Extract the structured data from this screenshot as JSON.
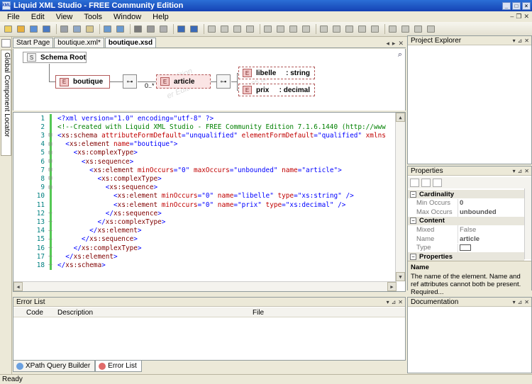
{
  "window": {
    "title": "Liquid XML Studio - FREE Community Edition",
    "app_icon_text": "XML"
  },
  "menu": [
    "File",
    "Edit",
    "View",
    "Tools",
    "Window",
    "Help"
  ],
  "toolbar": {
    "icons": [
      "new-file-icon",
      "open-folder-icon",
      "save-icon",
      "save-all-icon",
      "cut-icon",
      "copy-icon",
      "paste-icon",
      "undo-icon",
      "redo-icon",
      "print-icon",
      "print-preview-icon",
      "find-icon",
      "back-icon",
      "forward-icon",
      "schema-tree-icon",
      "schema-tree-icon",
      "schema-tree-icon",
      "schema-tree-icon",
      "element-icon",
      "element-icon",
      "element-icon",
      "element-icon",
      "attribute-icon",
      "attribute-icon",
      "attribute-icon",
      "attribute-icon",
      "attribute-icon",
      "validate-icon",
      "xml-icon",
      "search-icon",
      "options-icon"
    ]
  },
  "left_strip": {
    "tab_label": "Global Component Locator"
  },
  "doc_tabs": [
    {
      "label": "Start Page",
      "active": false
    },
    {
      "label": "boutique.xml*",
      "active": false
    },
    {
      "label": "boutique.xsd",
      "active": true
    }
  ],
  "schema_diagram": {
    "root_label": "Schema Root",
    "root_tag": "S",
    "element_tag": "E",
    "boutique": "boutique",
    "article": "article",
    "occurs": "0..*",
    "libelle": {
      "name": "libelle",
      "type": ": string"
    },
    "prix": {
      "name": "prix",
      "type": ": decimal"
    },
    "watermark_1": "mas are",
    "watermark_2": "nity Edition",
    "watermark_3": "er Edition)"
  },
  "code_lines": [
    {
      "n": "1",
      "fold": "",
      "parts": [
        [
          "p",
          "<?xml version=\"1.0\" encoding=\"utf-8\" ?>"
        ]
      ]
    },
    {
      "n": "2",
      "fold": "",
      "parts": [
        [
          "c",
          "<!--Created with Liquid XML Studio - FREE Community Edition 7.1.6.1440 (http://www"
        ]
      ]
    },
    {
      "n": "3",
      "fold": "⊟",
      "parts": [
        [
          "p",
          "<"
        ],
        [
          "k",
          "xs:schema"
        ],
        [
          "a",
          " attributeFormDefault"
        ],
        [
          "p",
          "=\"unqualified\""
        ],
        [
          "a",
          " elementFormDefault"
        ],
        [
          "p",
          "=\"qualified\""
        ],
        [
          "a",
          " xmlns"
        ]
      ]
    },
    {
      "n": "4",
      "fold": "⊟",
      "parts": [
        [
          "p",
          "  <"
        ],
        [
          "k",
          "xs:element"
        ],
        [
          "a",
          " name"
        ],
        [
          "p",
          "=\"boutique\">"
        ]
      ]
    },
    {
      "n": "5",
      "fold": "⊟",
      "parts": [
        [
          "p",
          "    <"
        ],
        [
          "k",
          "xs:complexType"
        ],
        [
          "p",
          ">"
        ]
      ]
    },
    {
      "n": "6",
      "fold": "⊟",
      "parts": [
        [
          "p",
          "      <"
        ],
        [
          "k",
          "xs:sequence"
        ],
        [
          "p",
          ">"
        ]
      ]
    },
    {
      "n": "7",
      "fold": "⊟",
      "parts": [
        [
          "p",
          "        <"
        ],
        [
          "k",
          "xs:element"
        ],
        [
          "a",
          " minOccurs"
        ],
        [
          "p",
          "=\"0\""
        ],
        [
          "a",
          " maxOccurs"
        ],
        [
          "p",
          "=\"unbounded\""
        ],
        [
          "a",
          " name"
        ],
        [
          "p",
          "=\"article\">"
        ]
      ]
    },
    {
      "n": "8",
      "fold": "⊟",
      "parts": [
        [
          "p",
          "          <"
        ],
        [
          "k",
          "xs:complexType"
        ],
        [
          "p",
          ">"
        ]
      ]
    },
    {
      "n": "9",
      "fold": "⊟",
      "parts": [
        [
          "p",
          "            <"
        ],
        [
          "k",
          "xs:sequence"
        ],
        [
          "p",
          ">"
        ]
      ]
    },
    {
      "n": "10",
      "fold": "",
      "parts": [
        [
          "p",
          "              <"
        ],
        [
          "k",
          "xs:element"
        ],
        [
          "a",
          " minOccurs"
        ],
        [
          "p",
          "=\"0\""
        ],
        [
          "a",
          " name"
        ],
        [
          "p",
          "=\"libelle\""
        ],
        [
          "a",
          " type"
        ],
        [
          "p",
          "=\"xs:string\" />"
        ]
      ]
    },
    {
      "n": "11",
      "fold": "",
      "parts": [
        [
          "p",
          "              <"
        ],
        [
          "k",
          "xs:element"
        ],
        [
          "a",
          " minOccurs"
        ],
        [
          "p",
          "=\"0\""
        ],
        [
          "a",
          " name"
        ],
        [
          "p",
          "=\"prix\""
        ],
        [
          "a",
          " type"
        ],
        [
          "p",
          "=\"xs:decimal\" />"
        ]
      ]
    },
    {
      "n": "12",
      "fold": "–",
      "parts": [
        [
          "p",
          "            </"
        ],
        [
          "k",
          "xs:sequence"
        ],
        [
          "p",
          ">"
        ]
      ]
    },
    {
      "n": "13",
      "fold": "–",
      "parts": [
        [
          "p",
          "          </"
        ],
        [
          "k",
          "xs:complexType"
        ],
        [
          "p",
          ">"
        ]
      ]
    },
    {
      "n": "14",
      "fold": "–",
      "parts": [
        [
          "p",
          "        </"
        ],
        [
          "k",
          "xs:element"
        ],
        [
          "p",
          ">"
        ]
      ]
    },
    {
      "n": "15",
      "fold": "–",
      "parts": [
        [
          "p",
          "      </"
        ],
        [
          "k",
          "xs:sequence"
        ],
        [
          "p",
          ">"
        ]
      ]
    },
    {
      "n": "16",
      "fold": "–",
      "parts": [
        [
          "p",
          "    </"
        ],
        [
          "k",
          "xs:complexType"
        ],
        [
          "p",
          ">"
        ]
      ]
    },
    {
      "n": "17",
      "fold": "–",
      "parts": [
        [
          "p",
          "  </"
        ],
        [
          "k",
          "xs:element"
        ],
        [
          "p",
          ">"
        ]
      ]
    },
    {
      "n": "18",
      "fold": "–",
      "parts": [
        [
          "p",
          "</"
        ],
        [
          "k",
          "xs:schema"
        ],
        [
          "p",
          ">"
        ]
      ]
    }
  ],
  "error_list": {
    "title": "Error List",
    "col_code": "Code",
    "col_description": "Description",
    "col_file": "File"
  },
  "bottom_tabs": [
    {
      "label": "XPath Query Builder",
      "active": false
    },
    {
      "label": "Error List",
      "active": true
    }
  ],
  "project_explorer": {
    "title": "Project Explorer"
  },
  "properties": {
    "title": "Properties",
    "rows": [
      {
        "kind": "cat",
        "label": "Cardinality"
      },
      {
        "kind": "prop",
        "label": "Min Occurs",
        "value": "0",
        "strong": true
      },
      {
        "kind": "prop",
        "label": "Max Occurs",
        "value": "unbounded",
        "strong": true
      },
      {
        "kind": "cat",
        "label": "Content"
      },
      {
        "kind": "prop",
        "label": "Mixed",
        "value": "False",
        "strong": false
      },
      {
        "kind": "prop",
        "label": "Name",
        "value": "article",
        "strong": true
      },
      {
        "kind": "prop",
        "label": "Type",
        "value": "",
        "strong": false
      },
      {
        "kind": "cat",
        "label": "Properties"
      }
    ],
    "desc_title": "Name",
    "desc_text": "The name of the element. Name and ref attributes cannot both be present. Required..."
  },
  "documentation": {
    "title": "Documentation"
  },
  "status": {
    "text": "Ready"
  },
  "colors": {
    "titlebar": "#1542b4",
    "element_border": "#b35b5b",
    "element_fill": "#f2c9c9"
  }
}
